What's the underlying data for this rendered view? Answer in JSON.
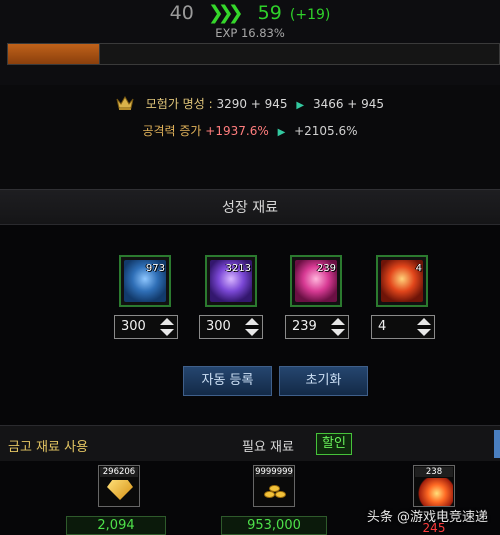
{
  "level": {
    "current": "40",
    "next": "59",
    "bonus": "(+19)"
  },
  "exp": {
    "text": "EXP 16.83%",
    "fraction": 0.1883
  },
  "stats": {
    "fame_label": "모험가 명성 :",
    "fame_value": "3290 + 945",
    "fame_next": "3466 + 945",
    "attack_label": "공격력 증가",
    "attack_current": "+1937.6%",
    "attack_next": "+2105.6%"
  },
  "section_title": "성장 재료",
  "materials": [
    {
      "count": "973",
      "input": "300",
      "icon": "blue-crystal-icon"
    },
    {
      "count": "3213",
      "input": "300",
      "icon": "purple-crystal-icon"
    },
    {
      "count": "239",
      "input": "239",
      "icon": "pink-crystal-icon"
    },
    {
      "count": "4",
      "input": "4",
      "icon": "fire-stone-icon"
    }
  ],
  "buttons": {
    "auto": "자동 등록",
    "reset": "초기화"
  },
  "bottom": {
    "vault_label": "금고 재료 사용",
    "need_label": "필요 재료",
    "discount": "할인"
  },
  "required": [
    {
      "count": "296206",
      "amount": "2,094",
      "icon": "gold-gem-icon"
    },
    {
      "count": "9999999",
      "amount": "953,000",
      "icon": "gold-coins-icon"
    },
    {
      "count": "238",
      "amount": "245",
      "icon": "fire-stone-icon"
    }
  ],
  "watermark": "头条 @游戏电竞速递",
  "colors": {
    "accent_green": "#2fd12a",
    "exp_orange": "#c0621a",
    "button_blue": "#25466f",
    "deficit_red": "#ff3b3b"
  }
}
